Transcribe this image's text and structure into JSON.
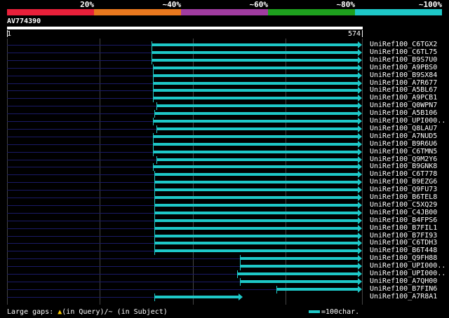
{
  "legend": {
    "colors": [
      "#e8203a",
      "#e8781e",
      "#a03ca0",
      "#1ea01e",
      "#1ec8c8"
    ],
    "labels": [
      "20%",
      "~40%",
      "~60%",
      "~80%",
      "~100%"
    ]
  },
  "query": {
    "name": "AV774390",
    "start": "1",
    "end": "574",
    "length": 574
  },
  "hits": [
    {
      "name": "UniRef100_C6TGX2",
      "start": 234,
      "end": 574
    },
    {
      "name": "UniRef100_C6TL75",
      "start": 234,
      "end": 574
    },
    {
      "name": "UniRef100_B9S7U0",
      "start": 234,
      "end": 574
    },
    {
      "name": "UniRef100_A9PBS0",
      "start": 237,
      "end": 574
    },
    {
      "name": "UniRef100_B9SX84",
      "start": 237,
      "end": 574
    },
    {
      "name": "UniRef100_A7R677",
      "start": 237,
      "end": 574
    },
    {
      "name": "UniRef100_A5BL67",
      "start": 237,
      "end": 574
    },
    {
      "name": "UniRef100_A9PCB1",
      "start": 237,
      "end": 574
    },
    {
      "name": "UniRef100_Q0WPN7",
      "start": 242,
      "end": 574
    },
    {
      "name": "UniRef100_A5B106",
      "start": 239,
      "end": 574
    },
    {
      "name": "UniRef100_UPI000..",
      "start": 237,
      "end": 574
    },
    {
      "name": "UniRef100_Q8LAU7",
      "start": 242,
      "end": 574
    },
    {
      "name": "UniRef100_A7NUD5",
      "start": 237,
      "end": 574
    },
    {
      "name": "UniRef100_B9R6U6",
      "start": 237,
      "end": 574
    },
    {
      "name": "UniRef100_C6TMN5",
      "start": 237,
      "end": 574
    },
    {
      "name": "UniRef100_Q9M2Y6",
      "start": 242,
      "end": 574
    },
    {
      "name": "UniRef100_B9GNK8",
      "start": 237,
      "end": 574
    },
    {
      "name": "UniRef100_C6T778",
      "start": 239,
      "end": 574
    },
    {
      "name": "UniRef100_B9EZG6",
      "start": 239,
      "end": 574
    },
    {
      "name": "UniRef100_Q9FU73",
      "start": 239,
      "end": 574
    },
    {
      "name": "UniRef100_B6TEL8",
      "start": 239,
      "end": 574
    },
    {
      "name": "UniRef100_C5XQ29",
      "start": 239,
      "end": 574
    },
    {
      "name": "UniRef100_C4JB00",
      "start": 239,
      "end": 574
    },
    {
      "name": "UniRef100_B4FPS6",
      "start": 239,
      "end": 574
    },
    {
      "name": "UniRef100_B7FIL1",
      "start": 239,
      "end": 574
    },
    {
      "name": "UniRef100_B7FI93",
      "start": 239,
      "end": 574
    },
    {
      "name": "UniRef100_C6TDH3",
      "start": 239,
      "end": 574
    },
    {
      "name": "UniRef100_B6T448",
      "start": 239,
      "end": 574
    },
    {
      "name": "UniRef100_Q9FH88",
      "start": 377,
      "end": 574
    },
    {
      "name": "UniRef100_UPI000..",
      "start": 377,
      "end": 574
    },
    {
      "name": "UniRef100_UPI000..",
      "start": 372,
      "end": 574
    },
    {
      "name": "UniRef100_A7QH00",
      "start": 377,
      "end": 574
    },
    {
      "name": "UniRef100_B7FIN6",
      "start": 436,
      "end": 574
    },
    {
      "name": "UniRef100_A7R8A1",
      "start": 239,
      "end": 381
    }
  ],
  "footer": {
    "gaps_prefix": "Large gaps: ",
    "gaps_query_mark": "▲",
    "gaps_text": "(in Query)/",
    "gaps_subject_mark": "~",
    "gaps_subject_text": " (in Subject)",
    "scale_text": "=100char."
  }
}
